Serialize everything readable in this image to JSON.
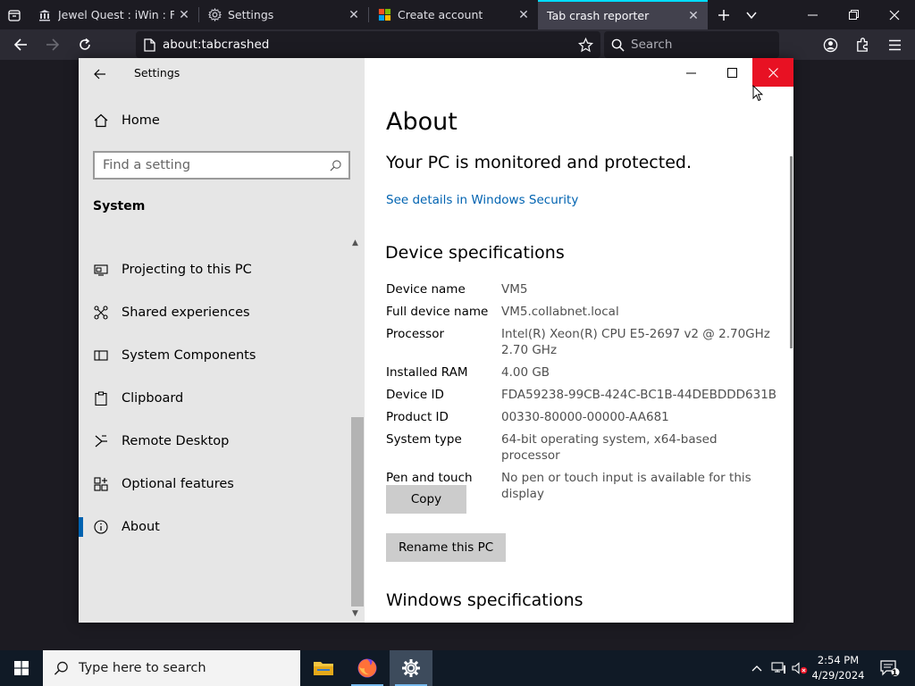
{
  "browser": {
    "tabs": [
      {
        "title": "Jewel Quest : iWin : Free I",
        "icon": "museum-icon",
        "active": false
      },
      {
        "title": "Settings",
        "icon": "gear-icon",
        "active": false
      },
      {
        "title": "Create account",
        "icon": "microsoft-logo-icon",
        "active": false
      },
      {
        "title": "Tab crash reporter",
        "icon": "none",
        "active": true
      }
    ],
    "url": "about:tabcrashed",
    "search_placeholder": "Search"
  },
  "settings": {
    "window_title": "Settings",
    "home_label": "Home",
    "search_placeholder": "Find a setting",
    "section": "System",
    "nav_items": [
      {
        "label": "Projecting to this PC",
        "icon": "projector-icon"
      },
      {
        "label": "Shared experiences",
        "icon": "shared-experiences-icon"
      },
      {
        "label": "System Components",
        "icon": "components-icon"
      },
      {
        "label": "Clipboard",
        "icon": "clipboard-icon"
      },
      {
        "label": "Remote Desktop",
        "icon": "remote-desktop-icon"
      },
      {
        "label": "Optional features",
        "icon": "optional-features-icon"
      },
      {
        "label": "About",
        "icon": "info-icon",
        "selected": true
      }
    ],
    "main": {
      "title": "About",
      "protection_status": "Your PC is monitored and protected.",
      "security_link": "See details in Windows Security",
      "specs_heading": "Device specifications",
      "specs": [
        {
          "label": "Device name",
          "value": "VM5"
        },
        {
          "label": "Full device name",
          "value": "VM5.collabnet.local"
        },
        {
          "label": "Processor",
          "value": "Intel(R) Xeon(R) CPU E5-2697 v2 @ 2.70GHz\n2.70 GHz"
        },
        {
          "label": "Installed RAM",
          "value": "4.00 GB"
        },
        {
          "label": "Device ID",
          "value": "FDA59238-99CB-424C-BC1B-44DEBDDD631B"
        },
        {
          "label": "Product ID",
          "value": "00330-80000-00000-AA681"
        },
        {
          "label": "System type",
          "value": "64-bit operating system, x64-based processor"
        },
        {
          "label": "Pen and touch",
          "value": "No pen or touch input is available for this display"
        }
      ],
      "copy_label": "Copy",
      "rename_label": "Rename this PC",
      "windows_spec_heading": "Windows specifications"
    }
  },
  "taskbar": {
    "search_placeholder": "Type here to search",
    "time": "2:54 PM",
    "date": "4/29/2024",
    "notification_count": "1"
  },
  "colors": {
    "accent": "#0063b1",
    "close_red": "#e81123",
    "firefox_tab_line": "#00ddff"
  }
}
